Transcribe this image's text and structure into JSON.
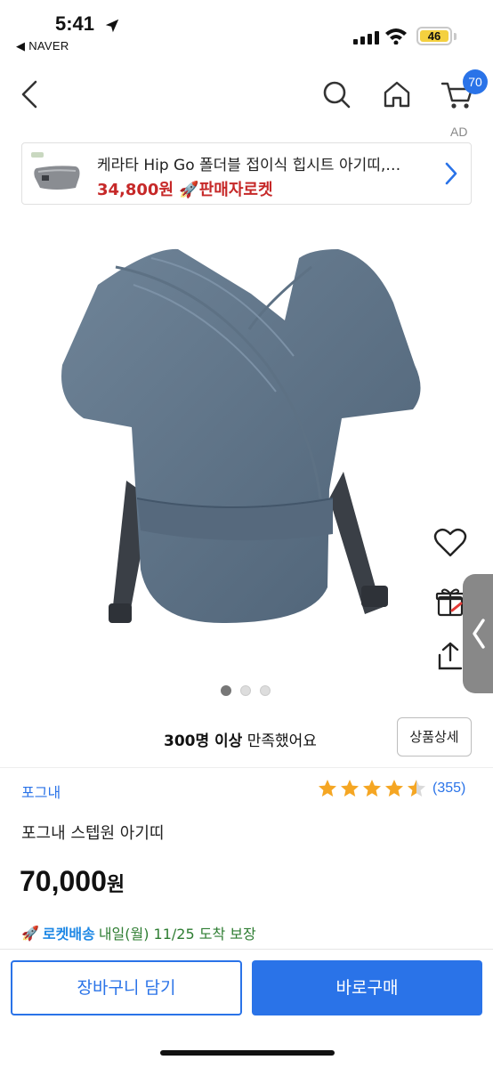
{
  "status_bar": {
    "time": "5:41",
    "back_app": "◀ NAVER",
    "battery": "46"
  },
  "nav": {
    "cart_count": "70",
    "ad_label": "AD"
  },
  "ad_banner": {
    "title": "케라타 Hip Go 폴더블 접이식 힙시트 아기띠,…",
    "price": "34,800원",
    "badge": "판매자로켓"
  },
  "gallery": {
    "total": 3,
    "current": 1
  },
  "satisfaction": {
    "strong": "300명 이상",
    "rest": " 만족했어요"
  },
  "detail_button": "상품상세",
  "product": {
    "brand": "포그내",
    "rating": 4.5,
    "review_count": "(355)",
    "name": "포그내 스텝원 아기띠",
    "price": "70,000",
    "price_unit": "원",
    "delivery_badge": "로켓배송",
    "delivery_text": "내일(월) 11/25 도착 보장"
  },
  "actions": {
    "add_to_cart": "장바구니 담기",
    "buy_now": "바로구매"
  },
  "colors": {
    "accent": "#2a73e8",
    "price_red": "#c62828",
    "delivery_green": "#2e7d32",
    "star": "#f5a623"
  }
}
